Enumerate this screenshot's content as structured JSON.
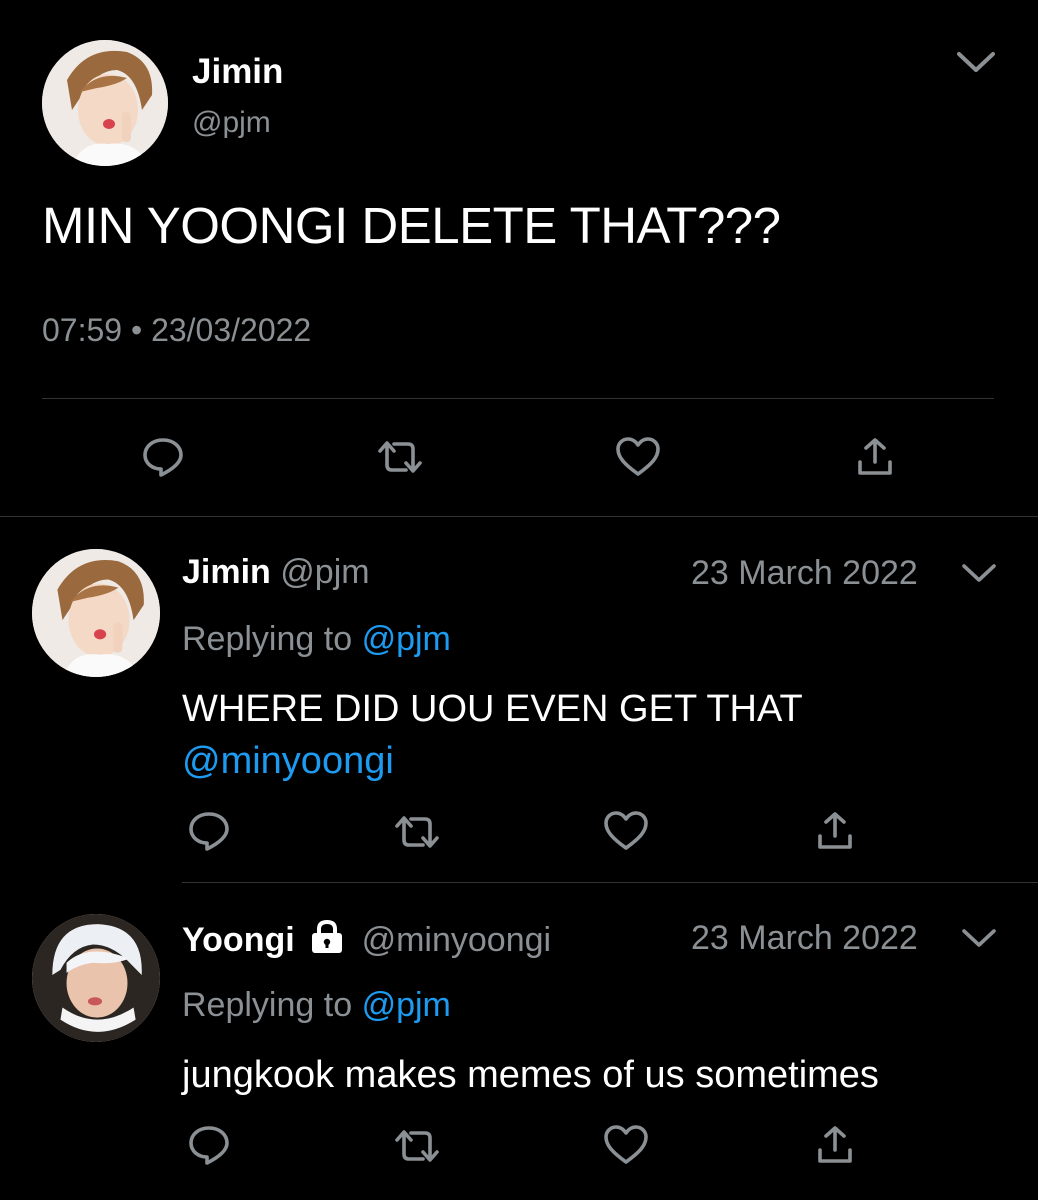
{
  "main_tweet": {
    "display_name": "Jimin",
    "handle": "@pjm",
    "text": "MIN YOONGI DELETE THAT???",
    "time": "07:59",
    "separator": "•",
    "date": "23/03/2022",
    "avatar": "jimin-avatar"
  },
  "replies": [
    {
      "display_name": "Jimin",
      "handle": "@pjm",
      "date": "23 March 2022",
      "replying_prefix": "Replying to",
      "replying_to": "@pjm",
      "text": "WHERE DID UOU EVEN GET THAT",
      "mention": "@minyoongi",
      "avatar": "jimin-avatar"
    },
    {
      "display_name": "Yoongi",
      "handle": "@minyoongi",
      "date": "23 March 2022",
      "replying_prefix": "Replying to",
      "replying_to": "@pjm",
      "text": "jungkook makes memes of us sometimes",
      "protected": true,
      "avatar": "yoongi-avatar"
    }
  ],
  "colors": {
    "background": "#000000",
    "text": "#ffffff",
    "muted": "#8b9094",
    "link": "#1d9bf0",
    "divider": "#2f3336"
  },
  "icons": [
    "reply-icon",
    "retweet-icon",
    "like-icon",
    "share-icon",
    "chevron-down-icon",
    "lock-icon"
  ]
}
